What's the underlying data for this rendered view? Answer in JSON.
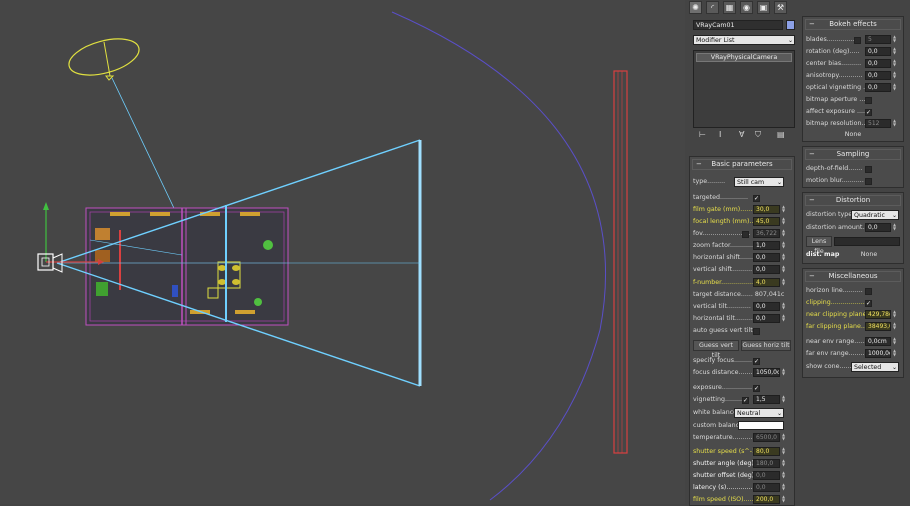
{
  "colors": {
    "selected": "#e6de4a",
    "frustum": "#6fd0ff",
    "wall": "#d94040",
    "arc": "#5050c0",
    "light": "#e0e040"
  },
  "tabs": [
    "create-icon",
    "modify-icon",
    "hierarchy-icon",
    "motion-icon",
    "display-icon",
    "utilities-icon"
  ],
  "object_name": "VRayCam01",
  "modifier_list": "Modifier List",
  "stack_item": "VRayPhysicalCamera",
  "basic": {
    "title": "Basic parameters",
    "type_label": "type.........",
    "type_value": "Still cam",
    "targeted": "targeted..............",
    "film_gate": "film gate (mm).......",
    "film_gate_v": "30,0",
    "focal_length": "focal length (mm)...",
    "focal_length_v": "45,0",
    "fov": "fov........................",
    "fov_v": "36,722",
    "zoom": "zoom factor............",
    "zoom_v": "1,0",
    "hshift": "horizontal shift.......",
    "hshift_v": "0,0",
    "vshift": "vertical shift..........",
    "vshift_v": "0,0",
    "fnumber": "f-number.................",
    "fnumber_v": "4,0",
    "target_dist": "target distance...... 807,041c",
    "vtilt": "vertical tilt............",
    "vtilt_v": "0,0",
    "htilt": "horizontal tilt.........",
    "htilt_v": "0,0",
    "auto_guess": "auto guess vert tilt..",
    "guess_vert": "Guess vert tilt",
    "guess_horiz": "Guess horiz tilt",
    "specify_focus": "specify focus.........",
    "focus_dist": "focus distance.........",
    "focus_dist_v": "1050,0c",
    "exposure": "exposure...............",
    "vignetting": "vignetting...........",
    "vignetting_v": "1,5",
    "white_balance": "white balance",
    "white_balance_v": "Neutral",
    "custom_balance": "custom balance .....",
    "temperature": "temperature.............",
    "temperature_v": "6500,0",
    "shutter_speed": "shutter speed (s^-1...",
    "shutter_speed_v": "80,0",
    "shutter_angle": "shutter angle (deg).",
    "shutter_angle_v": "180,0",
    "shutter_offset": "shutter offset (deg)..",
    "shutter_offset_v": "0,0",
    "latency": "latency (s)...............",
    "latency_v": "0,0",
    "film_speed": "film speed (ISO).......",
    "film_speed_v": "200,0"
  },
  "bokeh": {
    "title": "Bokeh effects",
    "blades": "blades................",
    "blades_v": "5",
    "rotation": "rotation (deg).....",
    "rotation_v": "0,0",
    "center_bias": "center bias..........",
    "center_bias_v": "0,0",
    "anisotropy": "anisotropy............",
    "anisotropy_v": "0,0",
    "optical": "optical vignetting ...",
    "optical_v": "0,0",
    "bitmap_aperture": "bitmap aperture ....",
    "affect_exposure": "affect exposure ....",
    "bitmap_res": "bitmap resolution....",
    "bitmap_res_v": "512",
    "none": "None"
  },
  "sampling": {
    "title": "Sampling",
    "dof": "depth-of-field.......",
    "motion_blur": "motion blur..........."
  },
  "distortion": {
    "title": "Distortion",
    "type": "distortion type.",
    "type_v": "Quadratic",
    "amount": "distortion amount...",
    "amount_v": "0,0",
    "lens_file": "Lens file",
    "dist_map": "dist. map",
    "none": "None"
  },
  "misc": {
    "title": "Miscellaneous",
    "horizon": "horizon line..........",
    "clipping": "clipping.................",
    "near_clip": "near clipping plane...",
    "near_clip_v": "429,78c",
    "far_clip": "far clipping plane....",
    "far_clip_v": "38493,0",
    "near_env": "near env range........",
    "near_env_v": "0,0cm",
    "far_env": "far env range.........",
    "far_env_v": "1000,0c",
    "show_cone": "show cone........",
    "show_cone_v": "Selected"
  }
}
